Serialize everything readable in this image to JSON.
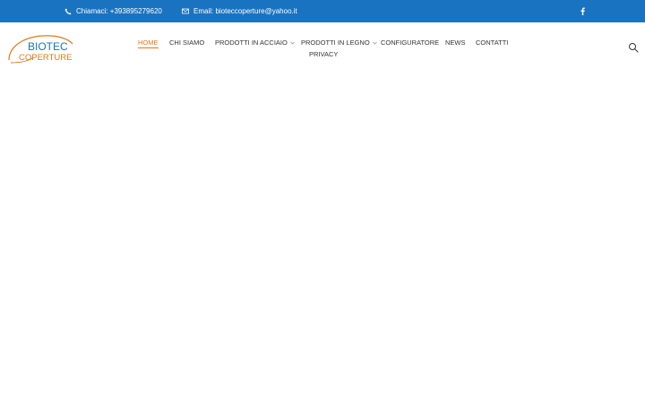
{
  "topbar": {
    "phone": {
      "icon": "phone-icon",
      "text": "Chiamaci: +393895279620"
    },
    "email": {
      "icon": "envelope-icon",
      "text": "Email: bioteccoperture@yahoo.it"
    },
    "social": {
      "icon": "facebook-icon"
    },
    "background": "#1a73c0"
  },
  "logo": {
    "line1": "BIOTEC",
    "line2": "COPERTURE",
    "accent": "#e27a18",
    "primary": "#1a73c0"
  },
  "nav": {
    "items": [
      {
        "label": "HOME",
        "active": true
      },
      {
        "label": "CHI SIAMO"
      },
      {
        "label": "PRODOTTI IN ACCIAIO",
        "dropdown": true
      },
      {
        "label": "PRODOTTI IN LEGNO",
        "dropdown": true
      },
      {
        "label": "CONFIGURATORE"
      },
      {
        "label": "NEWS"
      },
      {
        "label": "CONTATTI"
      },
      {
        "label": "PRIVACY"
      }
    ],
    "active_color": "#e27a18"
  },
  "search": {
    "icon": "search-icon"
  }
}
